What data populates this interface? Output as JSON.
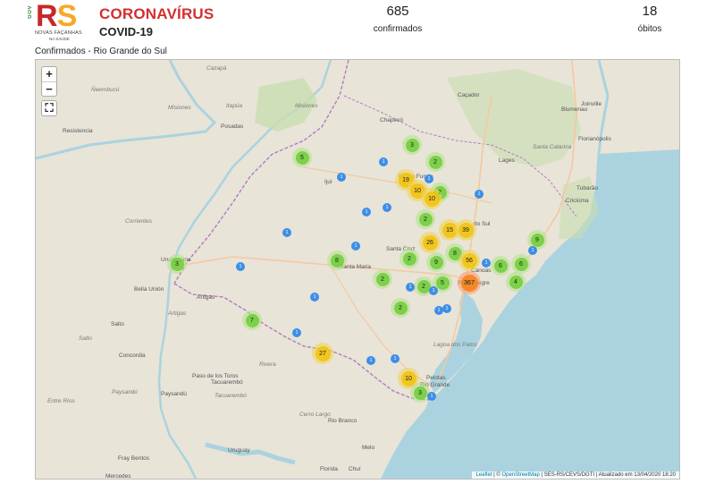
{
  "header": {
    "logo_gov": "GOV",
    "logo_r": "R",
    "logo_s": "S",
    "logo_tag": "NOVAS FAÇANHAS",
    "logo_tag2": "NA SAÚDE",
    "title": "CORONAVÍRUS",
    "subtitle": "COVID-19",
    "confirmed_count": "685",
    "confirmed_label": "confirmados",
    "deaths_count": "18",
    "deaths_label": "óbitos",
    "section_title": "Confirmados - Rio Grande do Sul"
  },
  "map_controls": {
    "zoom_in": "+",
    "zoom_out": "−",
    "fullscreen": "⛶"
  },
  "attribution": {
    "leaflet": "Leaflet",
    "sep1": " | © ",
    "osm": "OpenStreetMap",
    "rest": " | SES-RS/CEVS/DGTI | Atualizado em 13/04/2020 18:20"
  },
  "colors": {
    "cluster_small": "#6ecc39",
    "cluster_medium": "#f0c20c",
    "cluster_large": "#f18017",
    "single_case": "#3d8ee8",
    "land": "#e8e4d8",
    "water": "#aad3df",
    "forest": "#c8ddb0"
  },
  "places": [
    {
      "name": "Cazapá",
      "it": true
    },
    {
      "name": "Ñeembucú",
      "it": true
    },
    {
      "name": "Itapúa",
      "it": true
    },
    {
      "name": "Misiones",
      "it": true
    },
    {
      "name": "Misiones",
      "it": true
    },
    {
      "name": "Posadas",
      "it": false
    },
    {
      "name": "Resistencia",
      "it": false
    },
    {
      "name": "Corrientes",
      "it": true
    },
    {
      "name": "Uruguaiana",
      "it": false
    },
    {
      "name": "Bella Unión",
      "it": false
    },
    {
      "name": "Artigas",
      "it": false
    },
    {
      "name": "Artigas",
      "it": true
    },
    {
      "name": "Salto",
      "it": false
    },
    {
      "name": "Salto",
      "it": true
    },
    {
      "name": "Concordia",
      "it": false
    },
    {
      "name": "Entre Ríos",
      "it": true
    },
    {
      "name": "Paysandú",
      "it": false
    },
    {
      "name": "Paysandú",
      "it": true
    },
    {
      "name": "Paso de los Toros",
      "it": false
    },
    {
      "name": "Rivera",
      "it": true
    },
    {
      "name": "Tacuarembó",
      "it": false
    },
    {
      "name": "Tacuarembó",
      "it": true
    },
    {
      "name": "Cerro Largo",
      "it": true
    },
    {
      "name": "Rio Branco",
      "it": false
    },
    {
      "name": "Uruguay",
      "it": false
    },
    {
      "name": "Fray Bentos",
      "it": false
    },
    {
      "name": "Mercedes",
      "it": false
    },
    {
      "name": "Joinville",
      "it": false
    },
    {
      "name": "Blumenau",
      "it": false
    },
    {
      "name": "Caçador",
      "it": false
    },
    {
      "name": "Chapecó",
      "it": false
    },
    {
      "name": "Santa Catarina",
      "it": true
    },
    {
      "name": "Lages",
      "it": false
    },
    {
      "name": "Florianópolis",
      "it": false
    },
    {
      "name": "Tubarão",
      "it": false
    },
    {
      "name": "Criciúma",
      "it": false
    },
    {
      "name": "Ijuí",
      "it": false
    },
    {
      "name": "Passo Fundo",
      "it": false
    },
    {
      "name": "do Sul",
      "it": false
    },
    {
      "name": "Santa Cruz",
      "it": false
    },
    {
      "name": "Santa Maria",
      "it": false
    },
    {
      "name": "Canoas",
      "it": false
    },
    {
      "name": "Porto Alegre",
      "it": false
    },
    {
      "name": "Lagoa dos Patos",
      "it": true
    },
    {
      "name": "Pelotas",
      "it": false
    },
    {
      "name": "Rio Grande",
      "it": false
    },
    {
      "name": "Chuí",
      "it": false
    },
    {
      "name": "Florida",
      "it": false
    },
    {
      "name": "Melo",
      "it": false
    }
  ],
  "clusters": [
    {
      "count": 5,
      "size": "green"
    },
    {
      "count": 3,
      "size": "green"
    },
    {
      "count": 2,
      "size": "green"
    },
    {
      "count": 19,
      "size": "yellow"
    },
    {
      "count": 10,
      "size": "yellow"
    },
    {
      "count": 2,
      "size": "green"
    },
    {
      "count": 10,
      "size": "yellow"
    },
    {
      "count": 2,
      "size": "green"
    },
    {
      "count": 15,
      "size": "yellow"
    },
    {
      "count": 39,
      "size": "yellow"
    },
    {
      "count": 26,
      "size": "yellow"
    },
    {
      "count": 9,
      "size": "green"
    },
    {
      "count": 3,
      "size": "green"
    },
    {
      "count": 8,
      "size": "green"
    },
    {
      "count": 2,
      "size": "green"
    },
    {
      "count": 9,
      "size": "green"
    },
    {
      "count": 8,
      "size": "green"
    },
    {
      "count": 56,
      "size": "yellow"
    },
    {
      "count": 6,
      "size": "green"
    },
    {
      "count": 6,
      "size": "green"
    },
    {
      "count": 2,
      "size": "green"
    },
    {
      "count": 2,
      "size": "green"
    },
    {
      "count": 5,
      "size": "green"
    },
    {
      "count": 367,
      "size": "orange"
    },
    {
      "count": 4,
      "size": "green"
    },
    {
      "count": 2,
      "size": "green"
    },
    {
      "count": 7,
      "size": "green"
    },
    {
      "count": 27,
      "size": "yellow"
    },
    {
      "count": 10,
      "size": "yellow"
    },
    {
      "count": 3,
      "size": "green"
    },
    {
      "count": 1,
      "size": "blue"
    },
    {
      "count": 1,
      "size": "blue"
    },
    {
      "count": 1,
      "size": "blue"
    },
    {
      "count": 1,
      "size": "blue"
    },
    {
      "count": 1,
      "size": "blue"
    },
    {
      "count": 1,
      "size": "blue"
    },
    {
      "count": 1,
      "size": "blue"
    },
    {
      "count": 1,
      "size": "blue"
    },
    {
      "count": 1,
      "size": "blue"
    },
    {
      "count": 1,
      "size": "blue"
    },
    {
      "count": 1,
      "size": "blue"
    },
    {
      "count": 1,
      "size": "blue"
    },
    {
      "count": 1,
      "size": "blue"
    },
    {
      "count": 1,
      "size": "blue"
    },
    {
      "count": 1,
      "size": "blue"
    },
    {
      "count": 1,
      "size": "blue"
    },
    {
      "count": 1,
      "size": "blue"
    },
    {
      "count": 1,
      "size": "blue"
    },
    {
      "count": 1,
      "size": "blue"
    },
    {
      "count": 1,
      "size": "blue"
    }
  ]
}
